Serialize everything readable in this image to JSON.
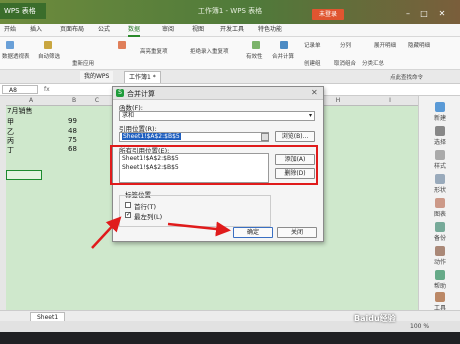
{
  "app": {
    "app_button": "WPS 表格",
    "window_title": "工作簿1 - WPS 表格",
    "login": "未登录",
    "controls": [
      "–",
      "□",
      "✕"
    ]
  },
  "menu": {
    "items": [
      "开始",
      "插入",
      "页面布局",
      "公式",
      "数据",
      "审阅",
      "视图",
      "开发工具",
      "特色功能"
    ],
    "active": "数据"
  },
  "ribbon": {
    "groups": [
      "数据透视表",
      "自动筛选",
      "重新应用",
      "高亮重复项",
      "拒绝录入重复项",
      "有效性",
      "合并计算",
      "记录单",
      "创建组",
      "取消组合",
      "分类汇总",
      "分列",
      "展开明细",
      "隐藏明细"
    ],
    "right_label": "点此查找命令"
  },
  "doc_tabs": [
    "我的WPS",
    "工作簿1 *"
  ],
  "formula_bar": {
    "name_box": "A8",
    "fx": "fx"
  },
  "sheet": {
    "columns": [
      "A",
      "B",
      "C",
      "D",
      "E",
      "F",
      "G",
      "H",
      "I"
    ],
    "header_cell": "7月销售",
    "rows": [
      {
        "name": "甲",
        "value": "99"
      },
      {
        "name": "乙",
        "value": "48"
      },
      {
        "name": "丙",
        "value": "75"
      },
      {
        "name": "丁",
        "value": "68"
      }
    ],
    "tab": "Sheet1"
  },
  "right_pane": [
    "新建",
    "选择",
    "样式",
    "形状",
    "图表",
    "备份",
    "动作",
    "帮助",
    "工具",
    "帮助"
  ],
  "dialog": {
    "title": "合并计算",
    "function_label": "函数(F):",
    "function_value": "求和",
    "ref_label": "引用位置(R):",
    "ref_value": "Sheet1!$A$2:$B$5",
    "browse_button": "浏览(B)...",
    "all_refs_label": "所有引用位置(E):",
    "all_refs": [
      "Sheet1!$A$2:$B$5",
      "Sheet1!$A$2:$B$5"
    ],
    "add_button": "添加(A)",
    "delete_button": "删除(D)",
    "label_pos_title": "标签位置",
    "top_row": "首行(T)",
    "left_col": "最左列(L)",
    "top_row_checked": false,
    "left_col_checked": true,
    "ok_button": "确定",
    "close_button": "关闭"
  },
  "status": {
    "zoom": "100 %"
  },
  "watermark": "Baidu经验",
  "colors": {
    "annotation_red": "#e01b1b",
    "accent_green": "#1e9b3a",
    "sheet_bg": "#cfe8cc"
  }
}
